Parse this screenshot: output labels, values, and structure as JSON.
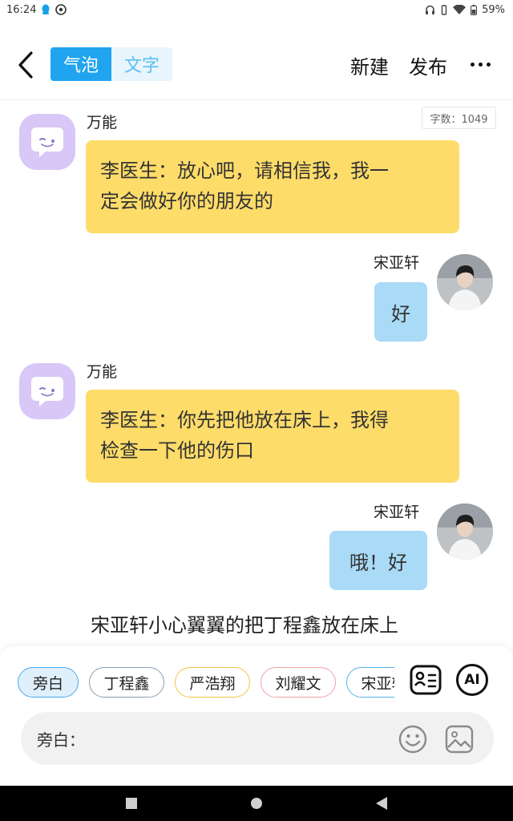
{
  "status_bar": {
    "time": "16:24",
    "battery": "59%"
  },
  "header": {
    "tabs": [
      "气泡",
      "文字"
    ],
    "new_label": "新建",
    "publish_label": "发布"
  },
  "word_count": "字数：1049",
  "messages": [
    {
      "side": "left",
      "sender": "万能",
      "text_lines": [
        "李医生：放心吧，请相信我，我一",
        "定会做好你的朋友的"
      ]
    },
    {
      "side": "right",
      "sender": "宋亚轩",
      "text": "好"
    },
    {
      "side": "left",
      "sender": "万能",
      "text_lines": [
        "李医生：你先把他放在床上，我得",
        "检查一下他的伤口"
      ]
    },
    {
      "side": "right",
      "sender": "宋亚轩",
      "text": "哦！好"
    }
  ],
  "narration": "宋亚轩小心翼翼的把丁程鑫放在床上",
  "characters": [
    {
      "name": "旁白",
      "color": "#4aa9ee"
    },
    {
      "name": "丁程鑫",
      "color": "#8a9db3"
    },
    {
      "name": "严浩翔",
      "color": "#f2c443"
    },
    {
      "name": "刘耀文",
      "color": "#f0a3a8"
    },
    {
      "name": "宋亚轩",
      "color": "#55b3ef"
    }
  ],
  "input": {
    "label": "旁白："
  },
  "tools": {
    "ai_label": "AI"
  },
  "colors": {
    "accent": "#21a4ef",
    "left_bubble": "#fedc6a",
    "right_bubble": "#a9daf6",
    "bot_avatar": "#d8c7f7"
  }
}
